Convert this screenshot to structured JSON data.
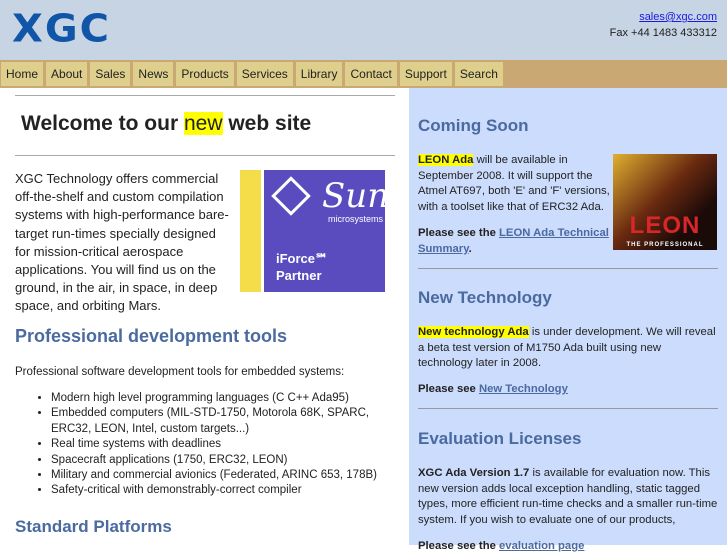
{
  "header": {
    "logo": "XGC",
    "email": "sales@xgc.com",
    "fax": "Fax +44 1483 433312"
  },
  "nav": [
    "Home",
    "About",
    "Sales",
    "News",
    "Products",
    "Services",
    "Library",
    "Contact",
    "Support",
    "Search"
  ],
  "left": {
    "welcome_pre": "Welcome to our ",
    "welcome_hl": "new",
    "welcome_post": " web site",
    "intro": "XGC Technology offers commercial off-the-shelf and custom compilation systems with high-performance bare-target run-times specially designed for mission-critical aerospace applications. You will find us on the ground, in the air, in space, in deep space, and orbiting Mars.",
    "sun_logo": "Sun",
    "sun_sub": "microsystems",
    "sun_partner1": "iForce℠",
    "sun_partner2": "Partner",
    "pdt_title": "Professional development tools",
    "pdt_intro": "Professional software development tools for embedded systems:",
    "pdt_items": [
      "Modern high level programming languages (C C++ Ada95)",
      "Embedded computers (MIL-STD-1750, Motorola 68K, SPARC, ERC32, LEON, Intel, custom targets...)",
      "Real time systems with deadlines",
      "Spacecraft applications (1750, ERC32, LEON)",
      "Military and commercial avionics (Federated, ARINC 653, 178B)",
      "Safety-critical with demonstrably-correct compiler"
    ],
    "std_title": "Standard Platforms"
  },
  "right": {
    "coming": {
      "title": "Coming Soon",
      "hl": "LEON Ada",
      "text": " will be available in September 2008. It will support the Atmel AT697, both 'E' and 'F' versions, with a toolset like that of ERC32 Ada.",
      "see": "Please see the ",
      "link": "LEON Ada Technical Summary",
      "end": ".",
      "poster_title": "LEON",
      "poster_sub": "THE PROFESSIONAL"
    },
    "newtech": {
      "title": "New Technology",
      "hl": "New technology Ada",
      "text": " is under development. We will reveal a beta test version of M1750 Ada built using new technology later in 2008.",
      "see": "Please see ",
      "link": "New Technology"
    },
    "eval": {
      "title": "Evaluation Licenses",
      "bold": "XGC Ada Version 1.7",
      "text": " is available for evaluation now. This new version adds local exception handling, static tagged types, more efficient run-time checks and a smaller run-time system. If you wish to evaluate one of our products,",
      "see": "Please see the ",
      "link": "evaluation page"
    }
  }
}
